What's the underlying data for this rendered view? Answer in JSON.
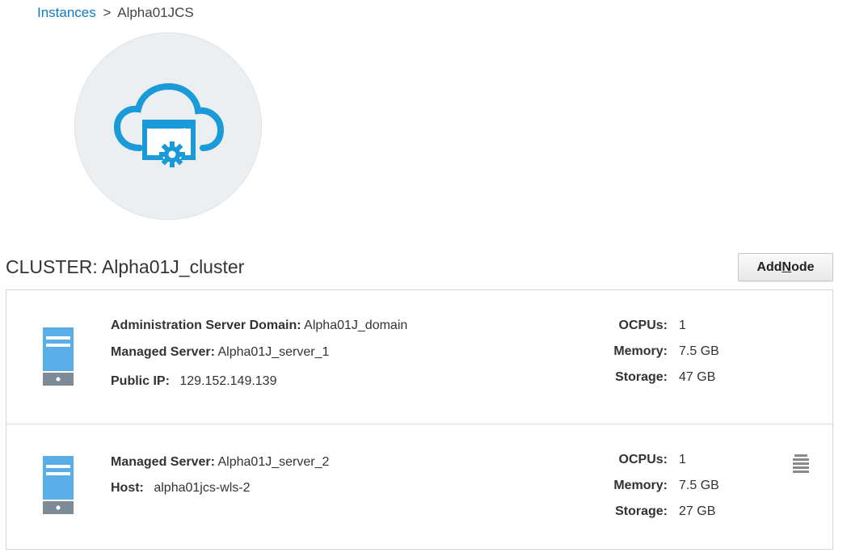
{
  "breadcrumb": {
    "link_label": "Instances",
    "separator": ">",
    "current": "Alpha01JCS"
  },
  "hero": {
    "icon": "cloud-gear-icon",
    "color": "#1a9ad8"
  },
  "cluster": {
    "title": "CLUSTER: Alpha01J_cluster",
    "add_node": {
      "prefix": "Add ",
      "mnemonic": "N",
      "suffix": "ode"
    }
  },
  "nodes": [
    {
      "icon": "server-icon",
      "details": [
        {
          "label": "Administration Server Domain:",
          "value": "Alpha01J_domain"
        },
        {
          "label": "Managed Server:",
          "value": "Alpha01J_server_1"
        },
        {
          "label": "Public IP:",
          "value": "129.152.149.139"
        }
      ],
      "specs": [
        {
          "label": "OCPUs:",
          "value": "1"
        },
        {
          "label": "Memory:",
          "value": "7.5 GB"
        },
        {
          "label": "Storage:",
          "value": "47 GB"
        }
      ]
    },
    {
      "icon": "server-icon",
      "details": [
        {
          "label": "Managed Server:",
          "value": "Alpha01J_server_2"
        },
        {
          "label": "Host:",
          "value": "alpha01jcs-wls-2"
        }
      ],
      "specs": [
        {
          "label": "OCPUs:",
          "value": "1"
        },
        {
          "label": "Memory:",
          "value": "7.5 GB"
        },
        {
          "label": "Storage:",
          "value": "27 GB"
        }
      ],
      "menu_icon": "row-menu-icon"
    }
  ],
  "colors": {
    "link": "#0e7ac4",
    "icon_blue": "#1a9ad8",
    "server_light": "#5aaee8",
    "server_dark": "#7d8b96"
  }
}
